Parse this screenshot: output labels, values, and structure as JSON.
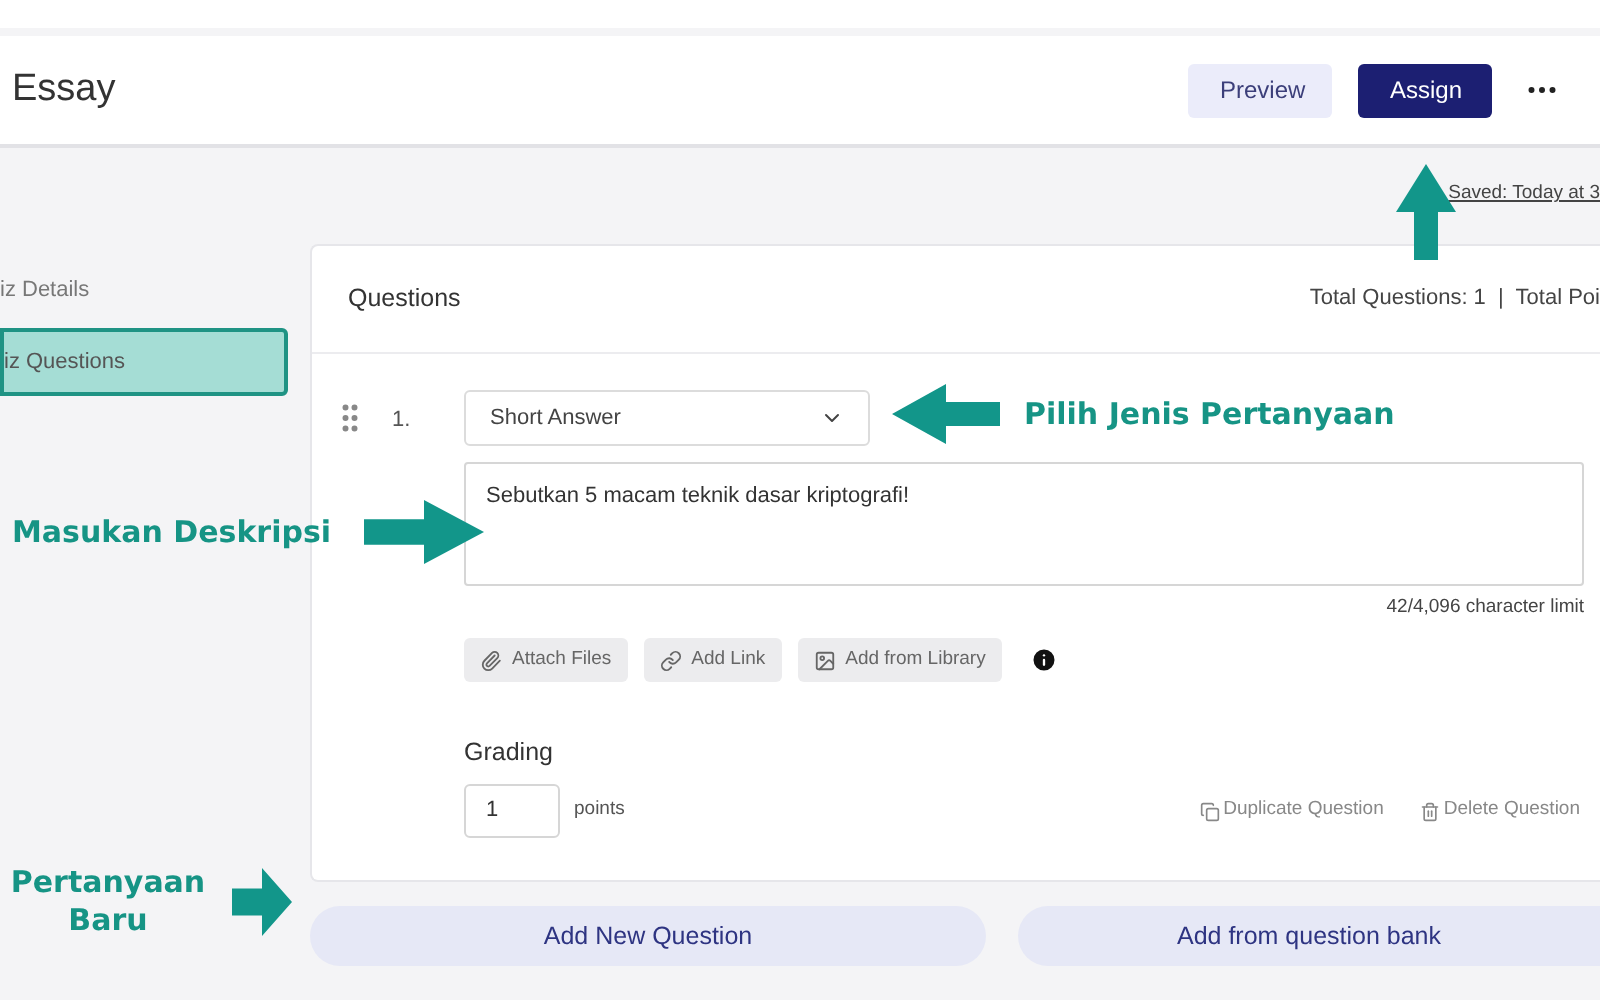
{
  "header": {
    "title": "Essay",
    "buttons": [
      {
        "label": "Preview",
        "kind": "secondary"
      },
      {
        "label": "Assign",
        "kind": "primary"
      }
    ]
  },
  "saved_text": "Saved: Today at 3",
  "sidebar": {
    "items": [
      {
        "label": "iz Details",
        "selected": false
      },
      {
        "label": "iz Questions",
        "selected": true
      }
    ]
  },
  "questions_panel": {
    "title": "Questions",
    "summary": "Total Questions: 1  |  Total Poi",
    "question": {
      "number": "1.",
      "type": "Short Answer",
      "text": "Sebutkan 5 macam teknik dasar kriptografi!",
      "char_limit": "42/4,096 character limit",
      "attachments": [
        {
          "label": "Attach Files",
          "kind": "file"
        },
        {
          "label": "Add Link",
          "kind": "link"
        },
        {
          "label": "Add from Library",
          "kind": "library"
        }
      ],
      "grading_label": "Grading",
      "points_value": "1",
      "points_unit": "points",
      "actions": [
        {
          "label": "Duplicate Question",
          "kind": "duplicate"
        },
        {
          "label": "Delete Question",
          "kind": "delete"
        }
      ]
    }
  },
  "add_buttons": [
    "Add New Question",
    "Add from question bank"
  ],
  "annotations": [
    {
      "kind": "arrow-up"
    },
    {
      "kind": "arrow-left",
      "text": "Pilih Jenis Pertanyaan"
    },
    {
      "kind": "arrow-right",
      "text": "Masukan Deskripsi"
    },
    {
      "kind": "arrow-right",
      "text": "Pertanyaan Baru"
    }
  ]
}
